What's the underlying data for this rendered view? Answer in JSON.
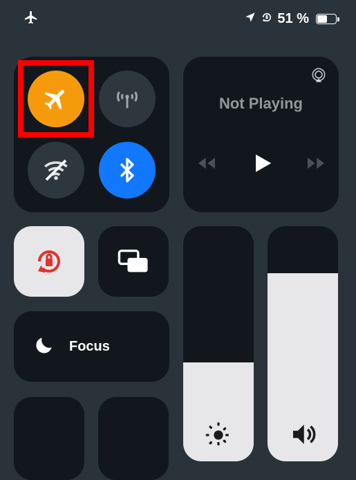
{
  "statusbar": {
    "battery_percent": "51 %"
  },
  "media": {
    "title": "Not Playing"
  },
  "focus": {
    "label": "Focus"
  },
  "connectivity": {
    "airplane": {
      "active": true,
      "color": "#f59b0b"
    },
    "cellular": {
      "active": false,
      "color": "#2f373e"
    },
    "wifi": {
      "active": false,
      "color": "#2f373e"
    },
    "bluetooth": {
      "active": true,
      "color": "#1178ff"
    }
  },
  "sliders": {
    "brightness_level": 42,
    "volume_level": 80
  },
  "highlight": {
    "target": "airplane"
  }
}
